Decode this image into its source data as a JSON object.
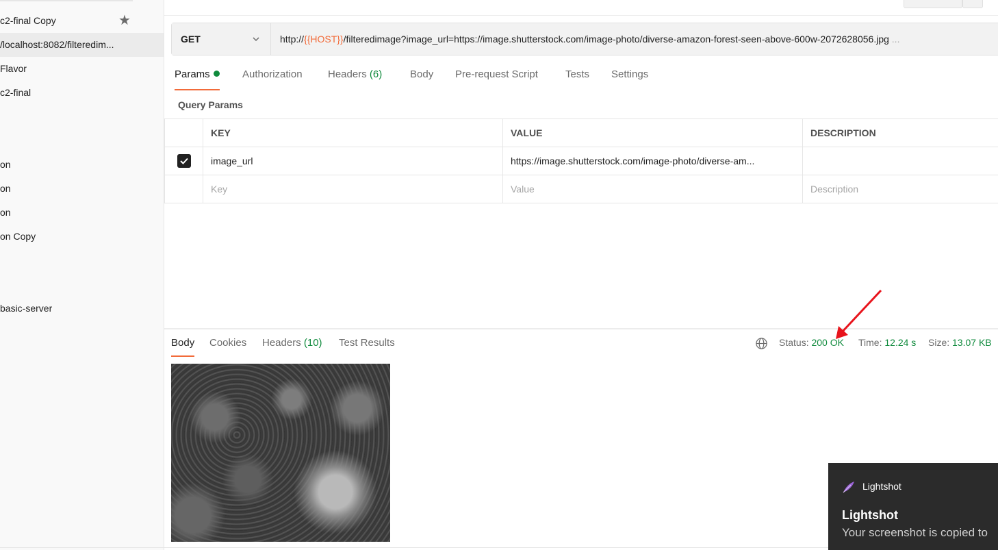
{
  "sidebar": {
    "items": [
      {
        "label": "c2-final Copy",
        "starred": true
      },
      {
        "label": "/localhost:8082/filteredim..."
      },
      {
        "label": " Flavor"
      },
      {
        "label": "c2-final"
      },
      {
        "label": "on"
      },
      {
        "label": "on"
      },
      {
        "label": "on"
      },
      {
        "label": "on Copy"
      },
      {
        "label": "basic-server"
      }
    ]
  },
  "request": {
    "method": "GET",
    "url_prefix": "http://",
    "url_var": "{{HOST}}",
    "url_suffix": "/filteredimage?image_url=https://image.shutterstock.com/image-photo/diverse-amazon-forest-seen-above-600w-2072628056.jpg",
    "url_overflow": " ..."
  },
  "request_tabs": {
    "params": "Params",
    "authorization": "Authorization",
    "headers": "Headers",
    "headers_count": "(6)",
    "body": "Body",
    "prerequest": "Pre-request Script",
    "tests": "Tests",
    "settings": "Settings"
  },
  "query_params": {
    "title": "Query Params",
    "headers": {
      "key": "KEY",
      "value": "VALUE",
      "description": "DESCRIPTION"
    },
    "rows": [
      {
        "checked": true,
        "key": "image_url",
        "value": "https://image.shutterstock.com/image-photo/diverse-am...",
        "description": ""
      }
    ],
    "placeholders": {
      "key": "Key",
      "value": "Value",
      "description": "Description"
    }
  },
  "response_tabs": {
    "body": "Body",
    "cookies": "Cookies",
    "headers": "Headers",
    "headers_count": "(10)",
    "test_results": "Test Results"
  },
  "response_status": {
    "status_label": "Status:",
    "status_value": "200 OK",
    "time_label": "Time:",
    "time_value": "12.24 s",
    "size_label": "Size:",
    "size_value": "13.07 KB"
  },
  "toast": {
    "app": "Lightshot",
    "title": "Lightshot",
    "message": "Your screenshot is copied to"
  },
  "colors": {
    "accent": "#f26b3a",
    "success": "#0f8a3c",
    "annotation": "#e8141c"
  }
}
